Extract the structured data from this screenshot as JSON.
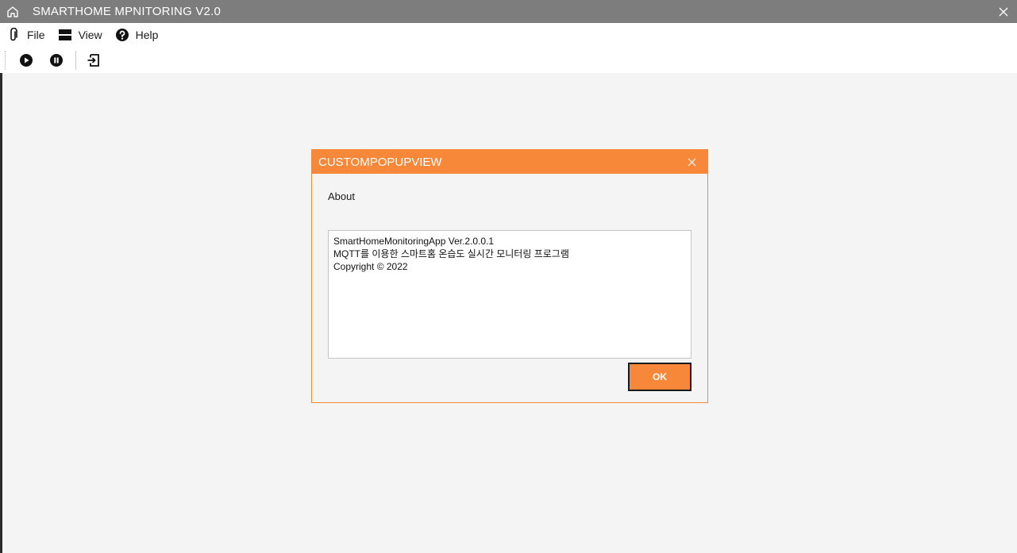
{
  "window": {
    "title": "SMARTHOME MPNITORING V2.0",
    "home_icon": "home-icon",
    "close_icon": "close-icon"
  },
  "menu": {
    "items": [
      {
        "label": "File",
        "icon": "paperclip-icon"
      },
      {
        "label": "View",
        "icon": "layout-icon"
      },
      {
        "label": "Help",
        "icon": "question-icon"
      }
    ]
  },
  "toolbar": {
    "buttons": [
      "play-icon",
      "pause-icon",
      "exit-icon"
    ]
  },
  "dialog": {
    "title": "CUSTOMPOPUPVIEW",
    "heading": "About",
    "text_lines": [
      "SmartHomeMonitoringApp Ver.2.0.0.1",
      "MQTT를 이용한 스마트홈 온습도 실시간 모니터링 프로그램",
      "Copyright ©  2022"
    ],
    "ok_label": "OK",
    "accent": "#f7883a"
  }
}
